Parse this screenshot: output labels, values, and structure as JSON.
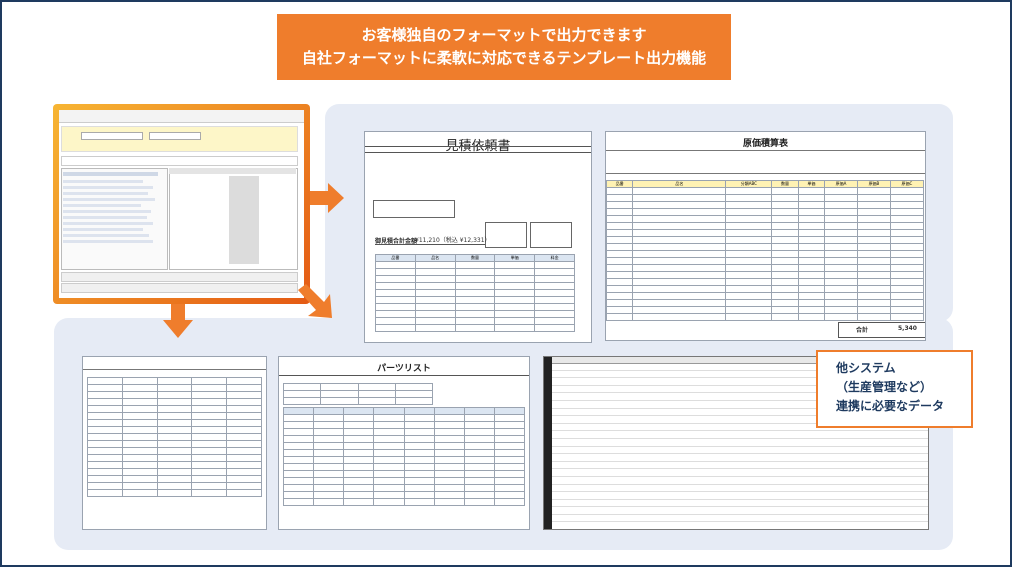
{
  "banner": {
    "line1": "お客様独自のフォーマットで出力できます",
    "line2": "自社フォーマットに柔軟に対応できるテンプレート出力機能"
  },
  "estimate_doc": {
    "title": "見積依頼書",
    "total_label": "御見積合計金額",
    "total_value": "¥11,210（税込 ¥12,331）",
    "table_headers": [
      "品番",
      "品名",
      "数量",
      "単価",
      "料金"
    ]
  },
  "cost_doc": {
    "title": "原価積算表",
    "table_headers": [
      "品番",
      "品名",
      "分類ABC",
      "数量",
      "単価",
      "原価A",
      "原価B",
      "原価C"
    ],
    "total_label": "合計",
    "total_value": "5,340"
  },
  "parts_doc": {
    "title": "パーツリスト"
  },
  "callout": {
    "line1": "他システム",
    "line2": "（生産管理など）",
    "line3": "連携に必要なデータ"
  },
  "colors": {
    "accent_orange": "#ef7d2c",
    "panel_bg": "#e6ebf5",
    "navy": "#1e3a5f"
  }
}
